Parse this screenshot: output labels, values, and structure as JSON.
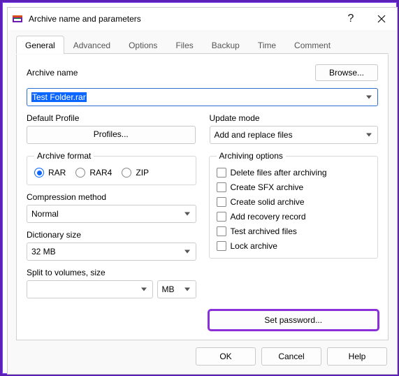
{
  "window": {
    "title": "Archive name and parameters"
  },
  "tabs": [
    "General",
    "Advanced",
    "Options",
    "Files",
    "Backup",
    "Time",
    "Comment"
  ],
  "general": {
    "archive_name_label": "Archive name",
    "browse_label": "Browse...",
    "archive_name_value": "Test Folder.rar",
    "default_profile_label": "Default Profile",
    "profiles_label": "Profiles...",
    "update_mode_label": "Update mode",
    "update_mode_value": "Add and replace files",
    "archive_format_label": "Archive format",
    "formats": {
      "rar": "RAR",
      "rar4": "RAR4",
      "zip": "ZIP"
    },
    "compression_label": "Compression method",
    "compression_value": "Normal",
    "dict_label": "Dictionary size",
    "dict_value": "32 MB",
    "split_label": "Split to volumes, size",
    "split_value": "",
    "split_unit": "MB",
    "archiving_options_label": "Archiving options",
    "opts": {
      "delete": "Delete files after archiving",
      "sfx": "Create SFX archive",
      "solid": "Create solid archive",
      "recovery": "Add recovery record",
      "test": "Test archived files",
      "lock": "Lock archive"
    },
    "set_password_label": "Set password..."
  },
  "footer": {
    "ok": "OK",
    "cancel": "Cancel",
    "help": "Help"
  }
}
